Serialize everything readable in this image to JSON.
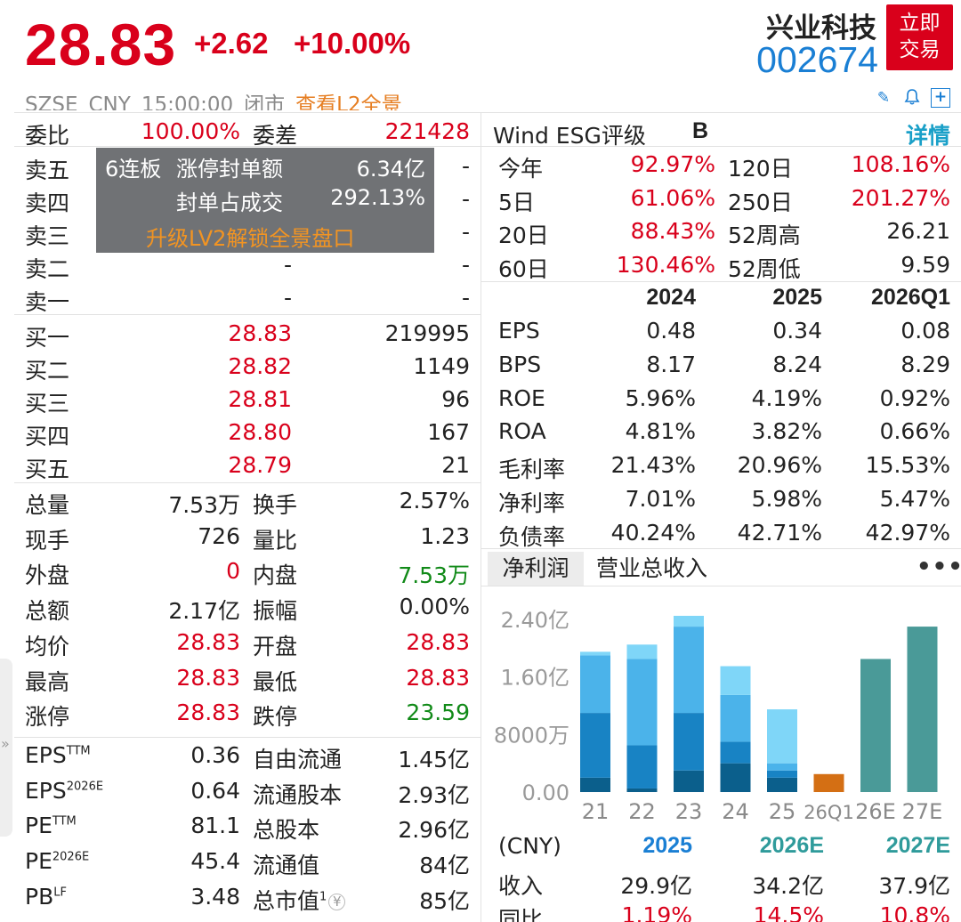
{
  "header": {
    "price": "28.83",
    "change": "+2.62",
    "change_pct": "+10.00%",
    "name": "兴业科技",
    "code": "002674",
    "trade_button_line1": "立即",
    "trade_button_line2": "交易",
    "exchange": "SZSE",
    "currency": "CNY",
    "time": "15:00:00",
    "status": "闭市",
    "l2_link": "查看L2全景"
  },
  "icons": [
    "pencil-icon",
    "bell-icon",
    "plus-icon"
  ],
  "order_book": {
    "weibi_label": "委比",
    "weibi_value": "100.00%",
    "weicha_label": "委差",
    "weicha_value": "221428",
    "sell": [
      {
        "label": "卖五",
        "price": "",
        "volume": "-"
      },
      {
        "label": "卖四",
        "price": "",
        "volume": "-"
      },
      {
        "label": "卖三",
        "price": "",
        "volume": "-"
      },
      {
        "label": "卖二",
        "price": "-",
        "volume": "-"
      },
      {
        "label": "卖一",
        "price": "-",
        "volume": "-"
      }
    ],
    "overlay": {
      "streak": "6连板",
      "seal_label": "涨停封单额",
      "seal_value": "6.34亿",
      "ratio_label": "封单占成交",
      "ratio_value": "292.13%",
      "upgrade": "升级LV2解锁全景盘口"
    },
    "buy": [
      {
        "label": "买一",
        "price": "28.83",
        "volume": "219995"
      },
      {
        "label": "买二",
        "price": "28.82",
        "volume": "1149"
      },
      {
        "label": "买三",
        "price": "28.81",
        "volume": "96"
      },
      {
        "label": "买四",
        "price": "28.80",
        "volume": "167"
      },
      {
        "label": "买五",
        "price": "28.79",
        "volume": "21"
      }
    ]
  },
  "stats": [
    {
      "l1": "总量",
      "v1": "7.53万",
      "c1": "dark",
      "l2": "换手",
      "v2": "2.57%",
      "c2": "dark"
    },
    {
      "l1": "现手",
      "v1": "726",
      "c1": "dark",
      "l2": "量比",
      "v2": "1.23",
      "c2": "dark"
    },
    {
      "l1": "外盘",
      "v1": "0",
      "c1": "red",
      "l2": "内盘",
      "v2": "7.53万",
      "c2": "green"
    },
    {
      "l1": "总额",
      "v1": "2.17亿",
      "c1": "dark",
      "l2": "振幅",
      "v2": "0.00%",
      "c2": "dark"
    },
    {
      "l1": "均价",
      "v1": "28.83",
      "c1": "red",
      "l2": "开盘",
      "v2": "28.83",
      "c2": "red"
    },
    {
      "l1": "最高",
      "v1": "28.83",
      "c1": "red",
      "l2": "最低",
      "v2": "28.83",
      "c2": "red"
    },
    {
      "l1": "涨停",
      "v1": "28.83",
      "c1": "red",
      "l2": "跌停",
      "v2": "23.59",
      "c2": "green"
    }
  ],
  "valuation": [
    {
      "l1": "EPS",
      "s1": "TTM",
      "v1": "0.36",
      "l2": "自由流通",
      "v2": "1.45亿"
    },
    {
      "l1": "EPS",
      "s1": "2026E",
      "v1": "0.64",
      "l2": "流通股本",
      "v2": "2.93亿"
    },
    {
      "l1": "PE",
      "s1": "TTM",
      "v1": "81.1",
      "l2": "总股本",
      "v2": "2.96亿"
    },
    {
      "l1": "PE",
      "s1": "2026E",
      "v1": "45.4",
      "l2": "流通值",
      "v2": "84亿"
    },
    {
      "l1": "PB",
      "s1": "LF",
      "v1": "3.48",
      "l2": "总市值",
      "v2": "85亿"
    }
  ],
  "market_cap_superscript": "1",
  "esg": {
    "label": "Wind ESG评级",
    "grade": "B",
    "detail": "详情"
  },
  "performance": [
    {
      "l1": "今年",
      "v1": "92.97%",
      "c1": "red",
      "l2": "120日",
      "v2": "108.16%",
      "c2": "red"
    },
    {
      "l1": "5日",
      "v1": "61.06%",
      "c1": "red",
      "l2": "250日",
      "v2": "201.27%",
      "c2": "red"
    },
    {
      "l1": "20日",
      "v1": "88.43%",
      "c1": "red",
      "l2": "52周高",
      "v2": "26.21",
      "c2": "dark"
    },
    {
      "l1": "60日",
      "v1": "130.46%",
      "c1": "red",
      "l2": "52周低",
      "v2": "9.59",
      "c2": "dark"
    }
  ],
  "financials": {
    "years": [
      "2024",
      "2025",
      "2026Q1"
    ],
    "rows": [
      {
        "label": "EPS",
        "values": [
          "0.48",
          "0.34",
          "0.08"
        ]
      },
      {
        "label": "BPS",
        "values": [
          "8.17",
          "8.24",
          "8.29"
        ]
      },
      {
        "label": "ROE",
        "values": [
          "5.96%",
          "4.19%",
          "0.92%"
        ]
      },
      {
        "label": "ROA",
        "values": [
          "4.81%",
          "3.82%",
          "0.66%"
        ]
      },
      {
        "label": "毛利率",
        "values": [
          "21.43%",
          "20.96%",
          "15.53%"
        ]
      },
      {
        "label": "净利率",
        "values": [
          "7.01%",
          "5.98%",
          "5.47%"
        ]
      },
      {
        "label": "负债率",
        "values": [
          "40.24%",
          "42.71%",
          "42.97%"
        ]
      }
    ]
  },
  "tabs": {
    "profit": "净利润",
    "revenue": "营业总收入"
  },
  "chart_data": {
    "type": "bar",
    "stacked": true,
    "categories": [
      "21",
      "22",
      "23",
      "24",
      "25",
      "26Q1",
      "26E",
      "27E"
    ],
    "y_ticks": [
      "0.00",
      "8000万",
      "1.60亿",
      "2.40亿"
    ],
    "ylim": [
      0,
      2.6
    ],
    "unit": "亿",
    "quarter_colors": [
      "#0b5f8c",
      "#1883c4",
      "#4bb3ea",
      "#7fd6f8"
    ],
    "stacks": [
      [
        0.2,
        0.9,
        0.8,
        0.05
      ],
      [
        0.05,
        0.6,
        1.2,
        0.2
      ],
      [
        0.3,
        0.8,
        1.2,
        0.15
      ],
      [
        0.4,
        0.3,
        0.65,
        0.4
      ],
      [
        0.2,
        0.1,
        0.1,
        0.75
      ],
      [
        0.25
      ],
      [
        1.85
      ],
      [
        2.3
      ]
    ],
    "stack_colors": [
      [
        "#0b5f8c",
        "#1883c4",
        "#4bb3ea",
        "#7fd6f8"
      ],
      [
        "#0b5f8c",
        "#1883c4",
        "#4bb3ea",
        "#7fd6f8"
      ],
      [
        "#0b5f8c",
        "#1883c4",
        "#4bb3ea",
        "#7fd6f8"
      ],
      [
        "#0b5f8c",
        "#1883c4",
        "#4bb3ea",
        "#7fd6f8"
      ],
      [
        "#0b5f8c",
        "#1883c4",
        "#4bb3ea",
        "#7fd6f8"
      ],
      [
        "#d46f14"
      ],
      [
        "#4a9a98"
      ],
      [
        "#4a9a98"
      ]
    ]
  },
  "forecast": {
    "currency_label": "(CNY)",
    "years": [
      "2025",
      "2026E",
      "2027E"
    ],
    "revenue_label": "收入",
    "revenue": [
      "29.9亿",
      "34.2亿",
      "37.9亿"
    ],
    "yoy_label": "同比",
    "yoy": [
      "1.19%",
      "14.5%",
      "10.8%"
    ]
  }
}
